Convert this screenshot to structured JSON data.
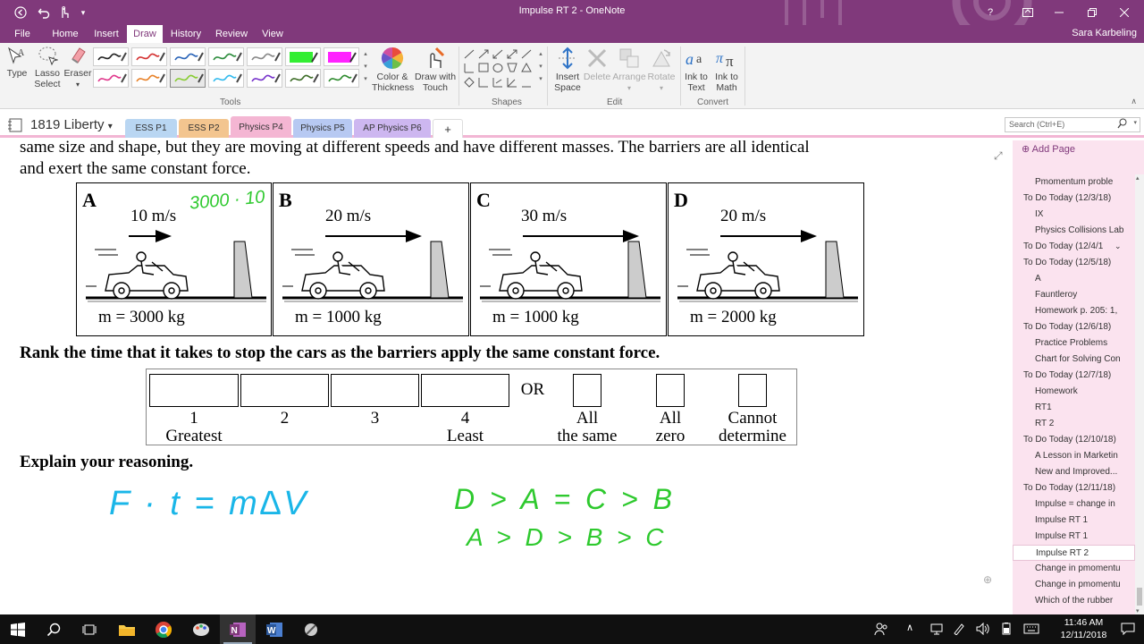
{
  "window": {
    "title": "Impulse RT 2 - OneNote",
    "user": "Sara Karbeling",
    "help": "?"
  },
  "ribbon_tabs": [
    "File",
    "Home",
    "Insert",
    "Draw",
    "History",
    "Review",
    "View"
  ],
  "ribbon": {
    "type_label": "Type",
    "lasso_label": [
      "Lasso",
      "Select"
    ],
    "eraser_label": "Eraser",
    "tools_group": "Tools",
    "color_label": [
      "Color &",
      "Thickness"
    ],
    "draw_touch_label": [
      "Draw with",
      "Touch"
    ],
    "shapes_group": "Shapes",
    "insert_space_label": [
      "Insert",
      "Space"
    ],
    "delete_label": "Delete",
    "arrange_label": "Arrange",
    "rotate_label": "Rotate",
    "edit_group": "Edit",
    "ink_text_label": [
      "Ink to",
      "Text"
    ],
    "ink_math_label": [
      "Ink to",
      "Math"
    ],
    "convert_group": "Convert",
    "pen_colors": [
      "#222222",
      "#d43131",
      "#2a64b8",
      "#2c8c3c",
      "#888888",
      "#33ee33",
      "#ff22ff",
      "#e0388c",
      "#e8822a",
      "#88cc33",
      "#33bbee",
      "#7733cc",
      "#3d6d27",
      "#2d8a2d"
    ]
  },
  "notebook": {
    "name": "1819 Liberty",
    "sections": [
      {
        "label": "ESS P1",
        "color": "#b9d6f2"
      },
      {
        "label": "ESS P2",
        "color": "#f3c58f"
      },
      {
        "label": "Physics P4",
        "color": "#f4b6d3"
      },
      {
        "label": "Physics P5",
        "color": "#b7c9f2"
      },
      {
        "label": "AP Physics P6",
        "color": "#cdb7f0"
      }
    ],
    "add_tab": "+",
    "search_placeholder": "Search (Ctrl+E)"
  },
  "content": {
    "intro_line1": "same size and shape, but they are moving at different speeds and have different masses. The barriers are all identical",
    "intro_line2": "and exert the same constant force.",
    "panels": [
      {
        "letter": "A",
        "speed": "10 m/s",
        "mass": "m = 3000 kg",
        "arrow_scale": 1
      },
      {
        "letter": "B",
        "speed": "20 m/s",
        "mass": "m = 1000 kg",
        "arrow_scale": 2
      },
      {
        "letter": "C",
        "speed": "30 m/s",
        "mass": "m = 1000 kg",
        "arrow_scale": 3
      },
      {
        "letter": "D",
        "speed": "20 m/s",
        "mass": "m = 2000 kg",
        "arrow_scale": 2
      }
    ],
    "question": "Rank the time that it takes to stop the cars as the barriers apply the same constant force.",
    "rank_labels": {
      "one": "1",
      "greatest": "Greatest",
      "two": "2",
      "three": "3",
      "four": "4",
      "least": "Least",
      "or": "OR",
      "all_same_1": "All",
      "all_same_2": "the same",
      "all_zero_1": "All",
      "all_zero_2": "zero",
      "cannot_1": "Cannot",
      "cannot_2": "determine"
    },
    "explain": "Explain your reasoning.",
    "ink_annotation": "3000 · 10",
    "ink_formula": "F · t = m∆V",
    "ink_rank_1": "D > A = C > B",
    "ink_rank_2": "A > D > B > C"
  },
  "pages": {
    "add_page": "Add Page",
    "items": [
      {
        "label": "Pmomentum proble",
        "indent": true
      },
      {
        "label": "To Do Today (12/3/18)",
        "indent": false
      },
      {
        "label": "IX",
        "indent": true
      },
      {
        "label": "Physics Collisions Lab",
        "indent": true
      },
      {
        "label": "To Do Today (12/4/1",
        "indent": false
      },
      {
        "label": "To Do Today (12/5/18)",
        "indent": false
      },
      {
        "label": "A",
        "indent": true
      },
      {
        "label": "Fauntleroy",
        "indent": true
      },
      {
        "label": "Homework p. 205: 1,",
        "indent": true
      },
      {
        "label": "To Do Today (12/6/18)",
        "indent": false
      },
      {
        "label": "Practice Problems",
        "indent": true
      },
      {
        "label": "Chart for Solving Con",
        "indent": true
      },
      {
        "label": "To Do Today (12/7/18)",
        "indent": false
      },
      {
        "label": "Homework",
        "indent": true
      },
      {
        "label": "RT1",
        "indent": true
      },
      {
        "label": "RT 2",
        "indent": true
      },
      {
        "label": "To Do Today (12/10/18)",
        "indent": false
      },
      {
        "label": "A Lesson in Marketin",
        "indent": true
      },
      {
        "label": "New and Improved...",
        "indent": true
      },
      {
        "label": "To Do Today (12/11/18)",
        "indent": false
      },
      {
        "label": "Impulse = change in",
        "indent": true
      },
      {
        "label": "Impulse RT 1",
        "indent": true
      },
      {
        "label": "Impulse RT 1",
        "indent": true
      },
      {
        "label": "Impulse RT 2",
        "indent": true,
        "selected": true
      },
      {
        "label": "Change in pmomentu",
        "indent": true
      },
      {
        "label": "Change in pmomentu",
        "indent": true
      },
      {
        "label": "Which of the rubber",
        "indent": true
      }
    ]
  },
  "taskbar": {
    "time": "11:46 AM",
    "date": "12/11/2018"
  }
}
